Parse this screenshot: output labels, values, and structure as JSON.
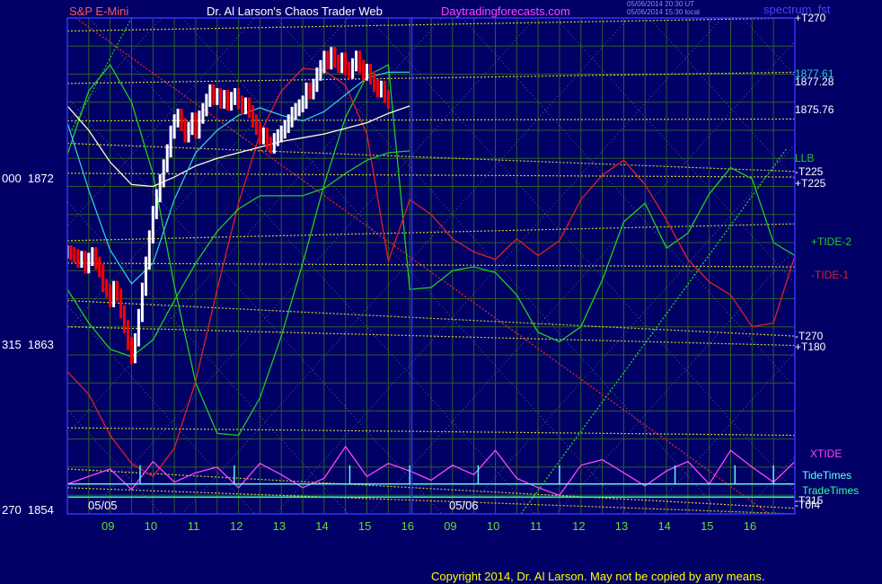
{
  "header": {
    "symbol": "S&P E-Mini",
    "title": "Dr. Al Larson's Chaos Trader Web",
    "site": "Daytradingforecasts.com",
    "stamp_ut": "05/06/2014 20:30 UT",
    "stamp_local": "05/06/2014 15:30 local",
    "source": "spectrum_fst"
  },
  "footer": {
    "copyright": "Copyright 2014, Dr. Al Larson. May not be copied by any means."
  },
  "colors": {
    "background": "#000066",
    "grid": "#2c5e2c",
    "frame": "#3333ff",
    "price_up": "#ffffff",
    "price_down": "#ff0000",
    "ma_fast": "#33cccc",
    "ma_slow": "#ffffcc",
    "tide_green": "#22cc22",
    "tide_red": "#dd2222",
    "xtide": "#ff44ff",
    "tidetimes": "#66ffff",
    "tradetimes": "#33ff99",
    "level_lines": "#cccc33"
  },
  "chart_data": {
    "type": "line",
    "title": "S&P E-Mini",
    "dates": [
      "05/05",
      "05/06"
    ],
    "x_ticks": {
      "05/05": [
        "09",
        "10",
        "11",
        "12",
        "13",
        "14",
        "15",
        "16"
      ],
      "05/06": [
        "09",
        "10",
        "11",
        "12",
        "13",
        "14",
        "15",
        "16"
      ]
    },
    "y_left_ticks": [
      {
        "label": "000  1872",
        "value": 1872
      },
      {
        "label": "315  1863",
        "value": 1863
      },
      {
        "label": "270  1854",
        "value": 1854
      }
    ],
    "price_labels": [
      "1877.61",
      "1877.28",
      "1875.76"
    ],
    "ylim": [
      1854,
      1880.5
    ],
    "right_labels": [
      {
        "text": "+T270",
        "color": "#ffffff"
      },
      {
        "text": "1877.61",
        "color": "#33cccc"
      },
      {
        "text": "1877.28",
        "color": "#ffffff"
      },
      {
        "text": "1875.76",
        "color": "#ffffff"
      },
      {
        "text": "LLB",
        "color": "#22cc22"
      },
      {
        "text": "-T225",
        "color": "#ffffff"
      },
      {
        "text": "+T225",
        "color": "#ffffff"
      },
      {
        "text": "+TIDE-2",
        "color": "#22cc22"
      },
      {
        "text": "-TIDE-1",
        "color": "#dd2222"
      },
      {
        "text": "-T270",
        "color": "#ffffff"
      },
      {
        "text": "+T180",
        "color": "#ffffff"
      },
      {
        "text": "XTIDE",
        "color": "#ff44ff"
      },
      {
        "text": "TideTimes",
        "color": "#66ffff"
      },
      {
        "text": "TradeTimes",
        "color": "#33ff99"
      },
      {
        "text": "-T315",
        "color": "#ffffff"
      },
      {
        "text": "-T0f4",
        "color": "#ffffff"
      }
    ],
    "ohlc_05_05": {
      "interval_minutes": 5,
      "note_colors": "white = up bar, red = down bar",
      "close": [
        1868.0,
        1867.9,
        1867.8,
        1867.5,
        1867.7,
        1867.2,
        1867.6,
        1867.9,
        1867.4,
        1867.0,
        1866.2,
        1865.9,
        1865.4,
        1866.1,
        1865.7,
        1864.8,
        1864.0,
        1863.1,
        1862.4,
        1863.3,
        1864.6,
        1866.0,
        1867.4,
        1868.8,
        1870.1,
        1871.0,
        1871.8,
        1872.6,
        1873.4,
        1874.4,
        1875.0,
        1875.3,
        1874.8,
        1874.2,
        1874.6,
        1875.1,
        1874.4,
        1875.2,
        1875.6,
        1876.1,
        1876.6,
        1876.2,
        1876.4,
        1876.0,
        1876.3,
        1875.9,
        1876.2,
        1876.4,
        1876.0,
        1875.7,
        1875.9,
        1875.5,
        1875.0,
        1874.6,
        1874.1,
        1874.3,
        1873.8,
        1873.6,
        1874.0,
        1874.2,
        1874.4,
        1874.7,
        1875.0,
        1875.4,
        1875.6,
        1875.8,
        1876.0,
        1876.7,
        1876.5,
        1876.9,
        1877.5,
        1877.9,
        1878.4,
        1878.1,
        1878.6,
        1878.2,
        1877.9,
        1878.3,
        1877.8,
        1877.6,
        1878.0,
        1878.4,
        1877.9,
        1877.5,
        1877.7,
        1877.3,
        1876.9,
        1876.6,
        1876.8,
        1876.3,
        1876.0
      ]
    },
    "series": [
      {
        "name": "LLB",
        "color": "#22cc22",
        "x": [
          8.0,
          8.5,
          9.0,
          9.5,
          10.0,
          10.5,
          11.0,
          11.5,
          12.0,
          12.5,
          13.0,
          13.5,
          14.0,
          14.5,
          15.0,
          15.5,
          16.0,
          16.5,
          17.0,
          17.5,
          18.0,
          18.5,
          19.0,
          19.5,
          20.0,
          20.5,
          21.0,
          21.5,
          22.0,
          22.5,
          23.0,
          23.5,
          24.0,
          24.5,
          25.0
        ],
        "y": [
          1873.2,
          1876.6,
          1878.0,
          1876.0,
          1872.2,
          1866.2,
          1861.0,
          1858.3,
          1858.2,
          1860.2,
          1863.5,
          1867.4,
          1871.6,
          1875.2,
          1877.4,
          1878.0,
          1866.0,
          1866.1,
          1867.0,
          1867.2,
          1866.9,
          1865.7,
          1863.7,
          1863.2,
          1864.0,
          1866.5,
          1869.6,
          1870.6,
          1868.2,
          1869.0,
          1871.1,
          1872.5,
          1871.9,
          1868.5,
          1867.8
        ]
      },
      {
        "name": "-TIDE-1",
        "color": "#dd2222",
        "x": [
          8.0,
          8.5,
          9.0,
          9.5,
          10.0,
          10.5,
          11.0,
          11.5,
          12.0,
          12.5,
          13.0,
          13.5,
          14.0,
          14.5,
          15.0,
          15.5,
          16.0,
          16.5,
          17.0,
          17.5,
          18.0,
          18.5,
          19.0,
          19.5,
          20.0,
          20.5,
          21.0,
          21.5,
          22.0,
          22.5,
          23.0,
          23.5,
          24.0,
          24.5,
          25.0
        ],
        "y": [
          1861.6,
          1860.4,
          1858.2,
          1856.7,
          1856.0,
          1857.5,
          1861.1,
          1866.0,
          1870.6,
          1874.3,
          1876.6,
          1877.8,
          1877.7,
          1876.9,
          1874.3,
          1867.5,
          1870.8,
          1870.0,
          1868.7,
          1868.0,
          1867.6,
          1868.7,
          1867.8,
          1868.6,
          1870.8,
          1872.1,
          1872.9,
          1871.6,
          1869.7,
          1867.6,
          1866.4,
          1865.7,
          1864.0,
          1864.2,
          1867.8
        ]
      },
      {
        "name": "+TIDE-2",
        "color": "#22cc22",
        "x": [
          8.0,
          8.5,
          9.0,
          9.5,
          10.0,
          10.5,
          11.0,
          11.5,
          12.0,
          12.5,
          13.0,
          13.5,
          14.0,
          14.5,
          15.0,
          15.5,
          16.0
        ],
        "y": [
          1866.0,
          1864.2,
          1862.8,
          1862.4,
          1863.3,
          1865.4,
          1867.4,
          1869.1,
          1870.3,
          1871.0,
          1871.0,
          1871.0,
          1871.4,
          1872.2,
          1872.9,
          1873.3,
          1873.4
        ]
      },
      {
        "name": "slow moving average",
        "color": "#ffffcc",
        "x": [
          8.0,
          8.5,
          9.0,
          9.5,
          10.0,
          10.5,
          11.0,
          11.5,
          12.0,
          12.5,
          13.0,
          13.5,
          14.0,
          14.5,
          15.0,
          15.5,
          16.0
        ],
        "y": [
          1875.8,
          1874.5,
          1872.8,
          1871.6,
          1871.5,
          1872.0,
          1872.6,
          1873.0,
          1873.3,
          1873.6,
          1873.9,
          1874.1,
          1874.3,
          1874.6,
          1874.9,
          1875.4,
          1875.8
        ]
      },
      {
        "name": "fast moving average",
        "color": "#33cccc",
        "x": [
          8.0,
          8.5,
          9.0,
          9.5,
          10.0,
          10.5,
          11.0,
          11.5,
          12.0,
          12.5,
          13.0,
          13.5,
          14.0,
          14.5,
          15.0,
          15.5,
          16.0
        ],
        "y": [
          1874.9,
          1871.3,
          1868.1,
          1866.3,
          1867.4,
          1870.8,
          1873.3,
          1874.5,
          1875.3,
          1875.7,
          1875.3,
          1875.0,
          1875.5,
          1876.4,
          1877.3,
          1877.6,
          1877.6
        ]
      },
      {
        "name": "XTIDE",
        "color": "#ff44ff",
        "x": [
          8.0,
          8.5,
          9.0,
          9.5,
          10.0,
          10.5,
          11.0,
          11.5,
          12.0,
          12.5,
          13.0,
          13.5,
          14.0,
          14.5,
          15.0,
          15.5,
          16.0,
          16.5,
          17.0,
          17.5,
          18.0,
          18.5,
          19.0,
          19.5,
          20.0,
          20.5,
          21.0,
          21.5,
          22.0,
          22.5,
          23.0,
          23.5,
          24.0,
          24.5,
          25.0
        ],
        "y": [
          1855.6,
          1856.0,
          1856.4,
          1855.3,
          1856.8,
          1855.7,
          1856.2,
          1856.5,
          1855.4,
          1856.7,
          1856.1,
          1855.4,
          1855.9,
          1857.6,
          1856.0,
          1856.7,
          1856.3,
          1855.8,
          1856.6,
          1856.1,
          1857.4,
          1855.9,
          1855.4,
          1855.0,
          1856.6,
          1856.9,
          1856.2,
          1855.5,
          1856.3,
          1856.8,
          1855.6,
          1857.4,
          1856.5,
          1855.7,
          1856.8
        ]
      }
    ],
    "level_lines": [
      "+T270",
      "-T225",
      "+T225",
      "-T270",
      "+T180",
      "-T315",
      "-T0f4"
    ],
    "grid": true,
    "legend": "right margin labels"
  }
}
